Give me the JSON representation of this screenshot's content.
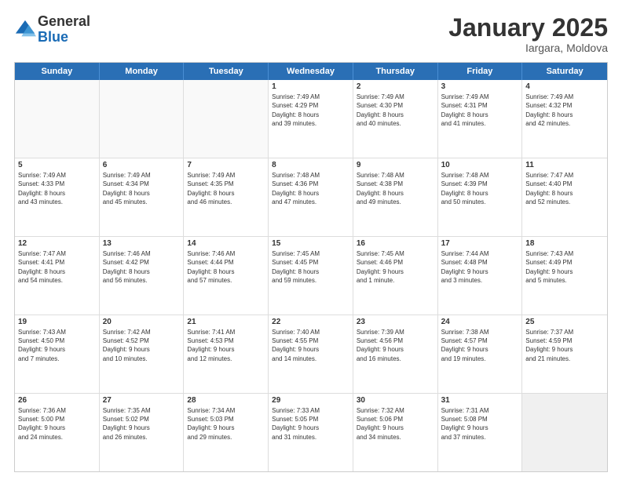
{
  "logo": {
    "general": "General",
    "blue": "Blue"
  },
  "header": {
    "title": "January 2025",
    "subtitle": "Iargara, Moldova"
  },
  "weekdays": [
    "Sunday",
    "Monday",
    "Tuesday",
    "Wednesday",
    "Thursday",
    "Friday",
    "Saturday"
  ],
  "rows": [
    [
      {
        "day": "",
        "info": ""
      },
      {
        "day": "",
        "info": ""
      },
      {
        "day": "",
        "info": ""
      },
      {
        "day": "1",
        "info": "Sunrise: 7:49 AM\nSunset: 4:29 PM\nDaylight: 8 hours\nand 39 minutes."
      },
      {
        "day": "2",
        "info": "Sunrise: 7:49 AM\nSunset: 4:30 PM\nDaylight: 8 hours\nand 40 minutes."
      },
      {
        "day": "3",
        "info": "Sunrise: 7:49 AM\nSunset: 4:31 PM\nDaylight: 8 hours\nand 41 minutes."
      },
      {
        "day": "4",
        "info": "Sunrise: 7:49 AM\nSunset: 4:32 PM\nDaylight: 8 hours\nand 42 minutes."
      }
    ],
    [
      {
        "day": "5",
        "info": "Sunrise: 7:49 AM\nSunset: 4:33 PM\nDaylight: 8 hours\nand 43 minutes."
      },
      {
        "day": "6",
        "info": "Sunrise: 7:49 AM\nSunset: 4:34 PM\nDaylight: 8 hours\nand 45 minutes."
      },
      {
        "day": "7",
        "info": "Sunrise: 7:49 AM\nSunset: 4:35 PM\nDaylight: 8 hours\nand 46 minutes."
      },
      {
        "day": "8",
        "info": "Sunrise: 7:48 AM\nSunset: 4:36 PM\nDaylight: 8 hours\nand 47 minutes."
      },
      {
        "day": "9",
        "info": "Sunrise: 7:48 AM\nSunset: 4:38 PM\nDaylight: 8 hours\nand 49 minutes."
      },
      {
        "day": "10",
        "info": "Sunrise: 7:48 AM\nSunset: 4:39 PM\nDaylight: 8 hours\nand 50 minutes."
      },
      {
        "day": "11",
        "info": "Sunrise: 7:47 AM\nSunset: 4:40 PM\nDaylight: 8 hours\nand 52 minutes."
      }
    ],
    [
      {
        "day": "12",
        "info": "Sunrise: 7:47 AM\nSunset: 4:41 PM\nDaylight: 8 hours\nand 54 minutes."
      },
      {
        "day": "13",
        "info": "Sunrise: 7:46 AM\nSunset: 4:42 PM\nDaylight: 8 hours\nand 56 minutes."
      },
      {
        "day": "14",
        "info": "Sunrise: 7:46 AM\nSunset: 4:44 PM\nDaylight: 8 hours\nand 57 minutes."
      },
      {
        "day": "15",
        "info": "Sunrise: 7:45 AM\nSunset: 4:45 PM\nDaylight: 8 hours\nand 59 minutes."
      },
      {
        "day": "16",
        "info": "Sunrise: 7:45 AM\nSunset: 4:46 PM\nDaylight: 9 hours\nand 1 minute."
      },
      {
        "day": "17",
        "info": "Sunrise: 7:44 AM\nSunset: 4:48 PM\nDaylight: 9 hours\nand 3 minutes."
      },
      {
        "day": "18",
        "info": "Sunrise: 7:43 AM\nSunset: 4:49 PM\nDaylight: 9 hours\nand 5 minutes."
      }
    ],
    [
      {
        "day": "19",
        "info": "Sunrise: 7:43 AM\nSunset: 4:50 PM\nDaylight: 9 hours\nand 7 minutes."
      },
      {
        "day": "20",
        "info": "Sunrise: 7:42 AM\nSunset: 4:52 PM\nDaylight: 9 hours\nand 10 minutes."
      },
      {
        "day": "21",
        "info": "Sunrise: 7:41 AM\nSunset: 4:53 PM\nDaylight: 9 hours\nand 12 minutes."
      },
      {
        "day": "22",
        "info": "Sunrise: 7:40 AM\nSunset: 4:55 PM\nDaylight: 9 hours\nand 14 minutes."
      },
      {
        "day": "23",
        "info": "Sunrise: 7:39 AM\nSunset: 4:56 PM\nDaylight: 9 hours\nand 16 minutes."
      },
      {
        "day": "24",
        "info": "Sunrise: 7:38 AM\nSunset: 4:57 PM\nDaylight: 9 hours\nand 19 minutes."
      },
      {
        "day": "25",
        "info": "Sunrise: 7:37 AM\nSunset: 4:59 PM\nDaylight: 9 hours\nand 21 minutes."
      }
    ],
    [
      {
        "day": "26",
        "info": "Sunrise: 7:36 AM\nSunset: 5:00 PM\nDaylight: 9 hours\nand 24 minutes."
      },
      {
        "day": "27",
        "info": "Sunrise: 7:35 AM\nSunset: 5:02 PM\nDaylight: 9 hours\nand 26 minutes."
      },
      {
        "day": "28",
        "info": "Sunrise: 7:34 AM\nSunset: 5:03 PM\nDaylight: 9 hours\nand 29 minutes."
      },
      {
        "day": "29",
        "info": "Sunrise: 7:33 AM\nSunset: 5:05 PM\nDaylight: 9 hours\nand 31 minutes."
      },
      {
        "day": "30",
        "info": "Sunrise: 7:32 AM\nSunset: 5:06 PM\nDaylight: 9 hours\nand 34 minutes."
      },
      {
        "day": "31",
        "info": "Sunrise: 7:31 AM\nSunset: 5:08 PM\nDaylight: 9 hours\nand 37 minutes."
      },
      {
        "day": "",
        "info": ""
      }
    ]
  ]
}
